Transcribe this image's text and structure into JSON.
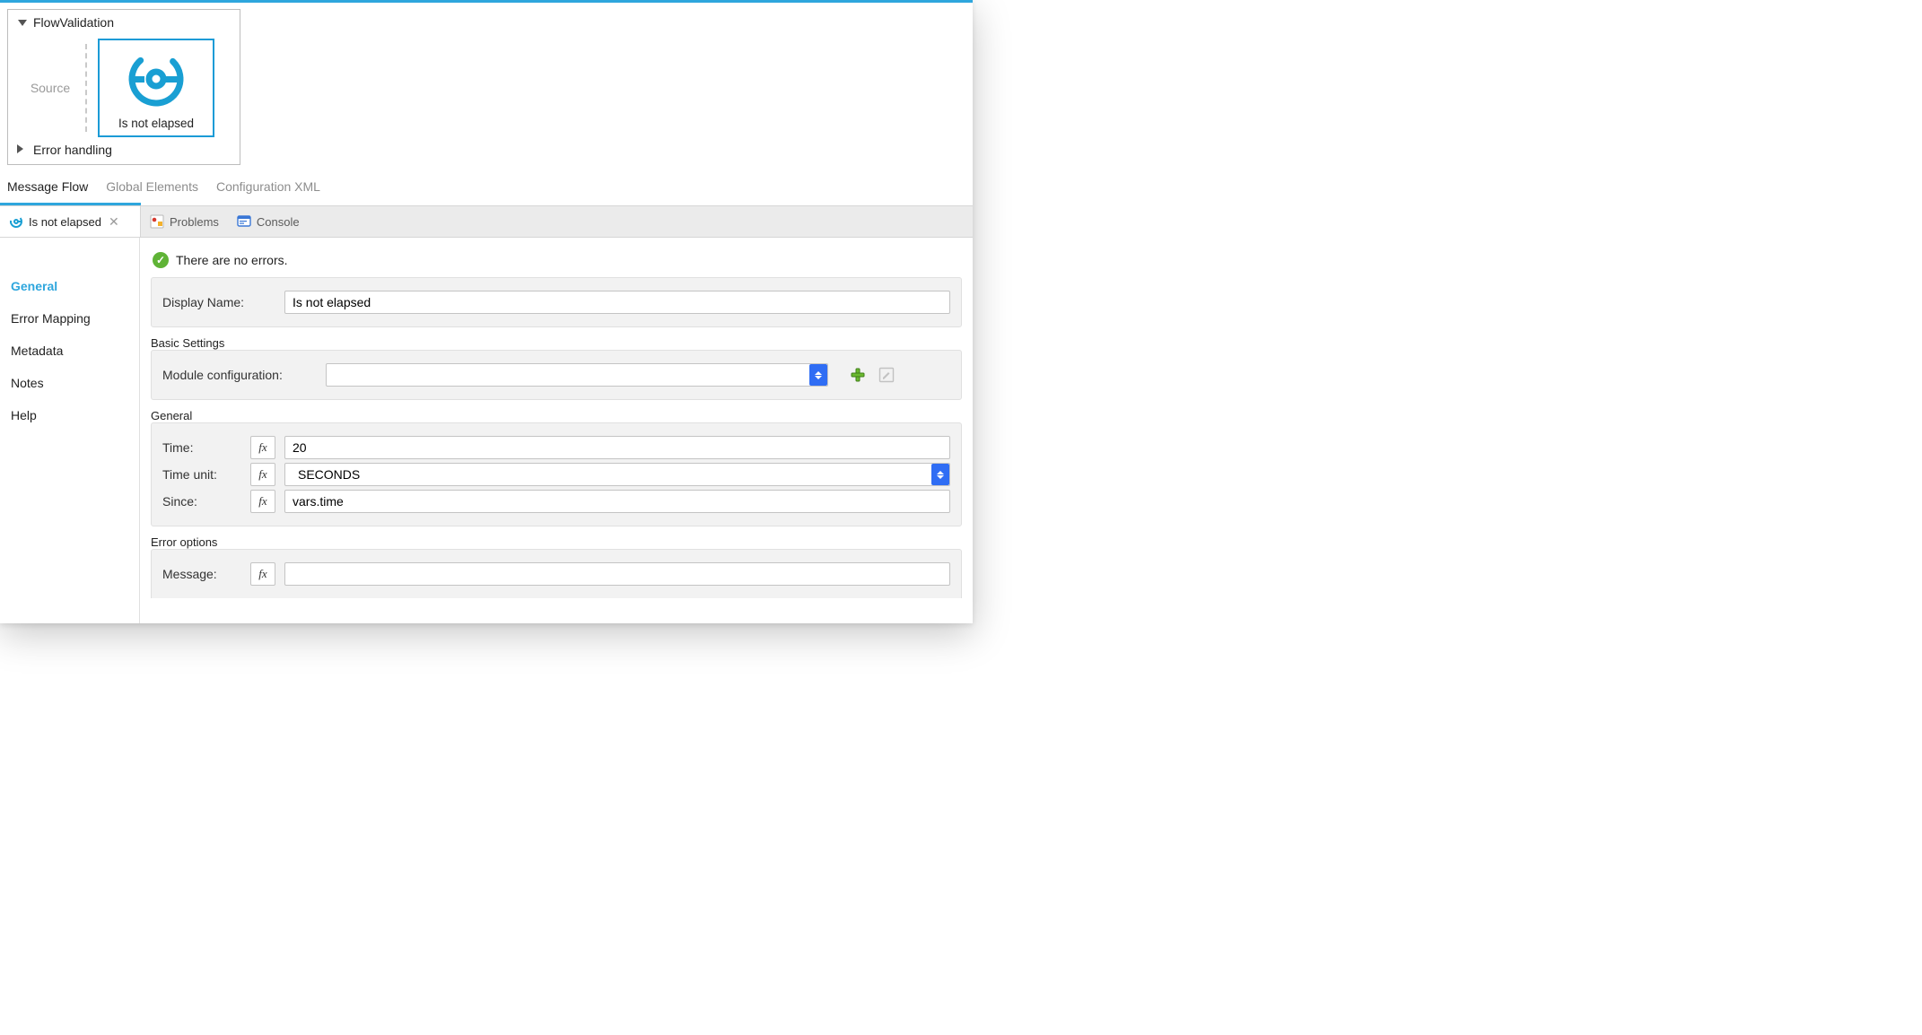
{
  "flow": {
    "name": "FlowValidation",
    "source_placeholder": "Source",
    "component_label": "Is not elapsed",
    "error_section": "Error handling"
  },
  "editor_tabs": {
    "message_flow": "Message Flow",
    "global_elements": "Global Elements",
    "config_xml": "Configuration XML"
  },
  "view_tabs": {
    "active": {
      "label": "Is not elapsed"
    },
    "problems": "Problems",
    "console": "Console"
  },
  "status_text": "There are no errors.",
  "sidebar": {
    "items": [
      {
        "label": "General"
      },
      {
        "label": "Error Mapping"
      },
      {
        "label": "Metadata"
      },
      {
        "label": "Notes"
      },
      {
        "label": "Help"
      }
    ]
  },
  "form": {
    "display_name_label": "Display Name:",
    "display_name_value": "Is not elapsed",
    "basic_settings_legend": "Basic Settings",
    "module_config_label": "Module configuration:",
    "module_config_value": "",
    "general_legend": "General",
    "time_label": "Time:",
    "time_value": "20",
    "time_unit_label": "Time unit:",
    "time_unit_value": "SECONDS",
    "since_label": "Since:",
    "since_value": "vars.time",
    "error_options_legend": "Error options",
    "message_label": "Message:",
    "message_value": ""
  },
  "fx_label": "fx"
}
